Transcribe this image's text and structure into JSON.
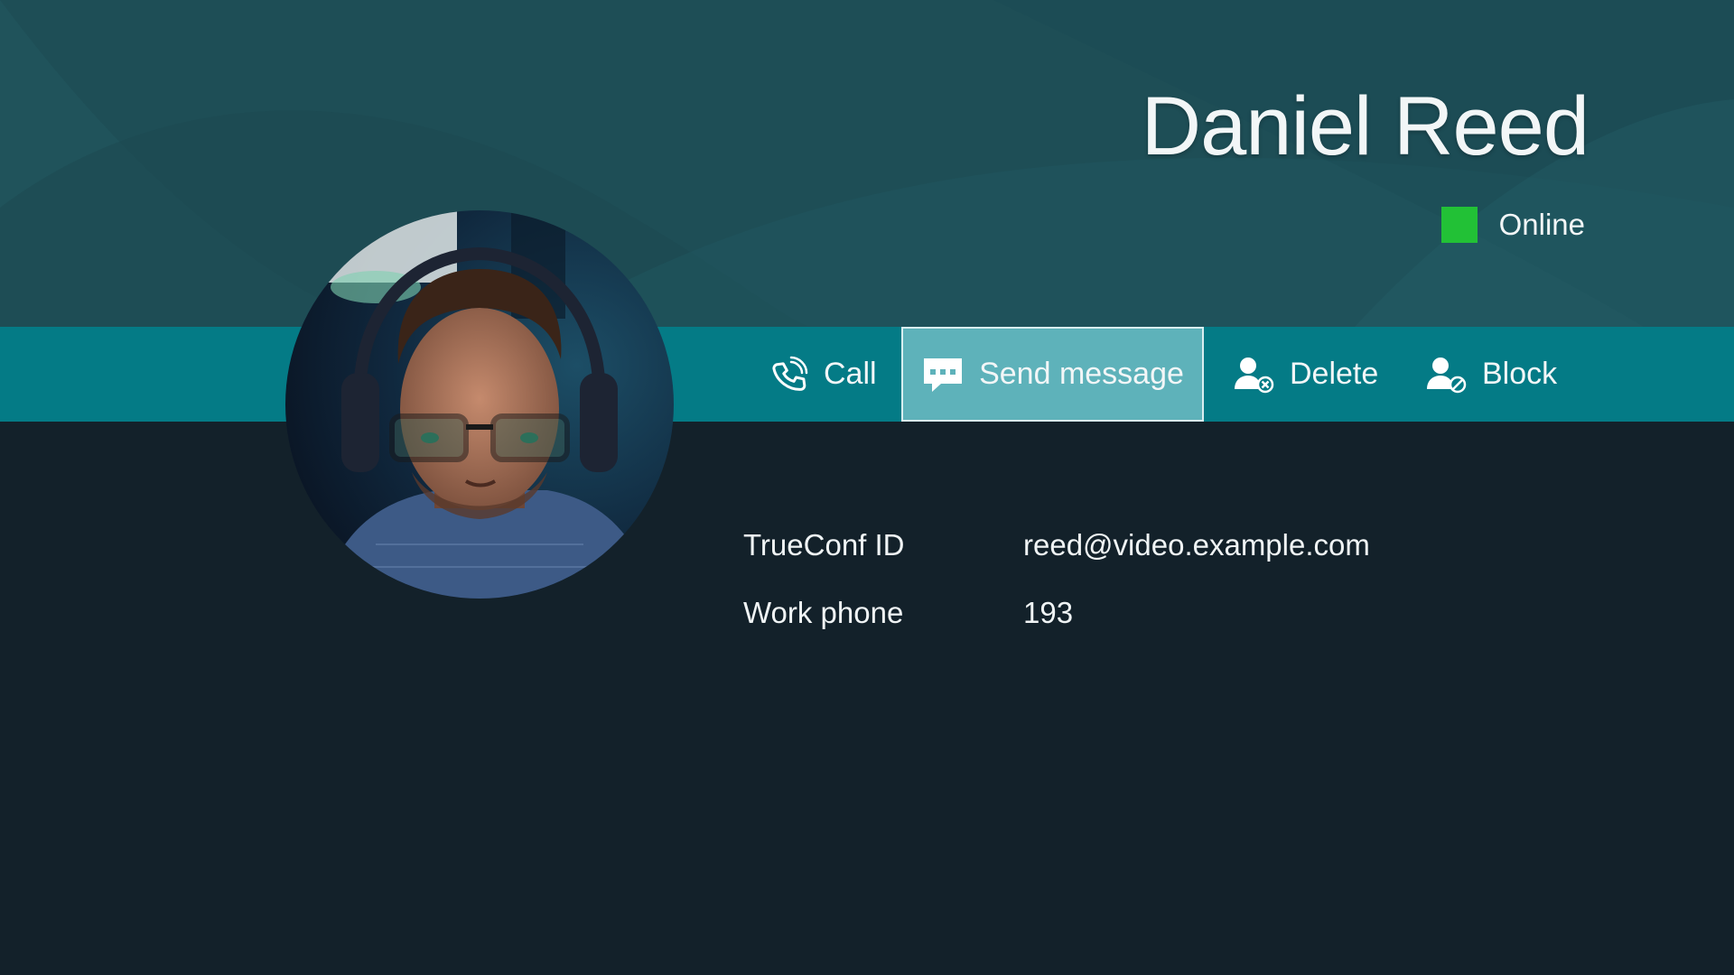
{
  "contact": {
    "name": "Daniel Reed",
    "status": "Online",
    "status_color": "#22c136"
  },
  "toolbar": {
    "call_label": "Call",
    "send_message_label": "Send message",
    "delete_label": "Delete",
    "block_label": "Block",
    "selected": "send_message"
  },
  "details": [
    {
      "label": "TrueConf ID",
      "value": "reed@video.example.com"
    },
    {
      "label": "Work phone",
      "value": "193"
    }
  ],
  "icons": {
    "call": "phone-icon",
    "send_message": "message-icon",
    "delete": "user-remove-icon",
    "block": "user-block-icon"
  },
  "colors": {
    "header_bg": "#1e4e56",
    "toolbar_bg": "#047b86",
    "selected_bg": "#5eb2ba",
    "page_bg": "#13212a"
  }
}
